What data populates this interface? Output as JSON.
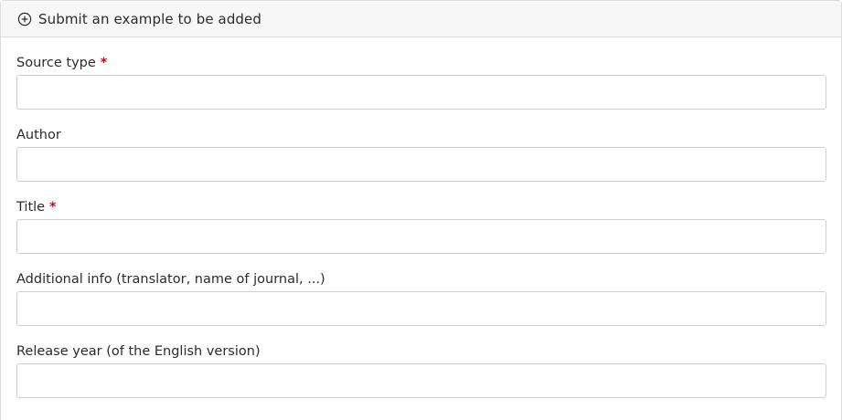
{
  "header": {
    "icon": "plus-circle-icon",
    "label": "Submit an example to be added"
  },
  "form": {
    "fields": [
      {
        "label": "Source type",
        "required": true,
        "required_mark": "*",
        "value": "",
        "placeholder": ""
      },
      {
        "label": "Author",
        "required": false,
        "required_mark": "",
        "value": "",
        "placeholder": ""
      },
      {
        "label": "Title",
        "required": true,
        "required_mark": "*",
        "value": "",
        "placeholder": ""
      },
      {
        "label": "Additional info (translator, name of journal, ...)",
        "required": false,
        "required_mark": "",
        "value": "",
        "placeholder": ""
      },
      {
        "label": "Release year (of the English version)",
        "required": false,
        "required_mark": "",
        "value": "",
        "placeholder": ""
      }
    ]
  },
  "colors": {
    "required": "#d0021b",
    "header_bg": "#f7f7f7",
    "border": "#cfcfcf"
  }
}
